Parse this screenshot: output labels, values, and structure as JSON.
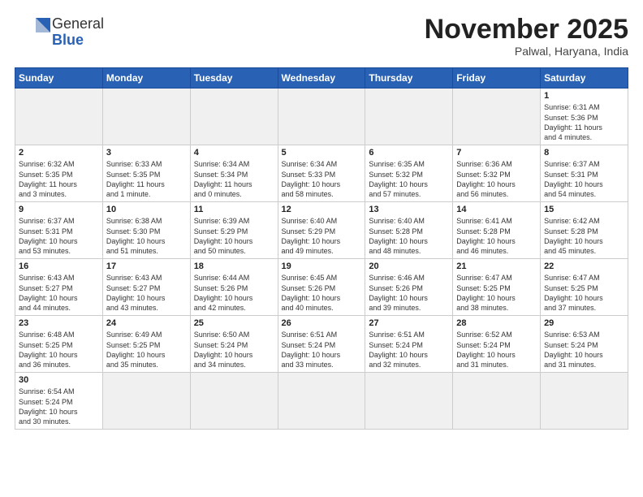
{
  "logo": {
    "text_normal": "General",
    "text_bold": "Blue"
  },
  "title": "November 2025",
  "subtitle": "Palwal, Haryana, India",
  "weekdays": [
    "Sunday",
    "Monday",
    "Tuesday",
    "Wednesday",
    "Thursday",
    "Friday",
    "Saturday"
  ],
  "weeks": [
    [
      {
        "day": "",
        "info": ""
      },
      {
        "day": "",
        "info": ""
      },
      {
        "day": "",
        "info": ""
      },
      {
        "day": "",
        "info": ""
      },
      {
        "day": "",
        "info": ""
      },
      {
        "day": "",
        "info": ""
      },
      {
        "day": "1",
        "info": "Sunrise: 6:31 AM\nSunset: 5:36 PM\nDaylight: 11 hours\nand 4 minutes."
      }
    ],
    [
      {
        "day": "2",
        "info": "Sunrise: 6:32 AM\nSunset: 5:35 PM\nDaylight: 11 hours\nand 3 minutes."
      },
      {
        "day": "3",
        "info": "Sunrise: 6:33 AM\nSunset: 5:35 PM\nDaylight: 11 hours\nand 1 minute."
      },
      {
        "day": "4",
        "info": "Sunrise: 6:34 AM\nSunset: 5:34 PM\nDaylight: 11 hours\nand 0 minutes."
      },
      {
        "day": "5",
        "info": "Sunrise: 6:34 AM\nSunset: 5:33 PM\nDaylight: 10 hours\nand 58 minutes."
      },
      {
        "day": "6",
        "info": "Sunrise: 6:35 AM\nSunset: 5:32 PM\nDaylight: 10 hours\nand 57 minutes."
      },
      {
        "day": "7",
        "info": "Sunrise: 6:36 AM\nSunset: 5:32 PM\nDaylight: 10 hours\nand 56 minutes."
      },
      {
        "day": "8",
        "info": "Sunrise: 6:37 AM\nSunset: 5:31 PM\nDaylight: 10 hours\nand 54 minutes."
      }
    ],
    [
      {
        "day": "9",
        "info": "Sunrise: 6:37 AM\nSunset: 5:31 PM\nDaylight: 10 hours\nand 53 minutes."
      },
      {
        "day": "10",
        "info": "Sunrise: 6:38 AM\nSunset: 5:30 PM\nDaylight: 10 hours\nand 51 minutes."
      },
      {
        "day": "11",
        "info": "Sunrise: 6:39 AM\nSunset: 5:29 PM\nDaylight: 10 hours\nand 50 minutes."
      },
      {
        "day": "12",
        "info": "Sunrise: 6:40 AM\nSunset: 5:29 PM\nDaylight: 10 hours\nand 49 minutes."
      },
      {
        "day": "13",
        "info": "Sunrise: 6:40 AM\nSunset: 5:28 PM\nDaylight: 10 hours\nand 48 minutes."
      },
      {
        "day": "14",
        "info": "Sunrise: 6:41 AM\nSunset: 5:28 PM\nDaylight: 10 hours\nand 46 minutes."
      },
      {
        "day": "15",
        "info": "Sunrise: 6:42 AM\nSunset: 5:28 PM\nDaylight: 10 hours\nand 45 minutes."
      }
    ],
    [
      {
        "day": "16",
        "info": "Sunrise: 6:43 AM\nSunset: 5:27 PM\nDaylight: 10 hours\nand 44 minutes."
      },
      {
        "day": "17",
        "info": "Sunrise: 6:43 AM\nSunset: 5:27 PM\nDaylight: 10 hours\nand 43 minutes."
      },
      {
        "day": "18",
        "info": "Sunrise: 6:44 AM\nSunset: 5:26 PM\nDaylight: 10 hours\nand 42 minutes."
      },
      {
        "day": "19",
        "info": "Sunrise: 6:45 AM\nSunset: 5:26 PM\nDaylight: 10 hours\nand 40 minutes."
      },
      {
        "day": "20",
        "info": "Sunrise: 6:46 AM\nSunset: 5:26 PM\nDaylight: 10 hours\nand 39 minutes."
      },
      {
        "day": "21",
        "info": "Sunrise: 6:47 AM\nSunset: 5:25 PM\nDaylight: 10 hours\nand 38 minutes."
      },
      {
        "day": "22",
        "info": "Sunrise: 6:47 AM\nSunset: 5:25 PM\nDaylight: 10 hours\nand 37 minutes."
      }
    ],
    [
      {
        "day": "23",
        "info": "Sunrise: 6:48 AM\nSunset: 5:25 PM\nDaylight: 10 hours\nand 36 minutes."
      },
      {
        "day": "24",
        "info": "Sunrise: 6:49 AM\nSunset: 5:25 PM\nDaylight: 10 hours\nand 35 minutes."
      },
      {
        "day": "25",
        "info": "Sunrise: 6:50 AM\nSunset: 5:24 PM\nDaylight: 10 hours\nand 34 minutes."
      },
      {
        "day": "26",
        "info": "Sunrise: 6:51 AM\nSunset: 5:24 PM\nDaylight: 10 hours\nand 33 minutes."
      },
      {
        "day": "27",
        "info": "Sunrise: 6:51 AM\nSunset: 5:24 PM\nDaylight: 10 hours\nand 32 minutes."
      },
      {
        "day": "28",
        "info": "Sunrise: 6:52 AM\nSunset: 5:24 PM\nDaylight: 10 hours\nand 31 minutes."
      },
      {
        "day": "29",
        "info": "Sunrise: 6:53 AM\nSunset: 5:24 PM\nDaylight: 10 hours\nand 31 minutes."
      }
    ],
    [
      {
        "day": "30",
        "info": "Sunrise: 6:54 AM\nSunset: 5:24 PM\nDaylight: 10 hours\nand 30 minutes."
      },
      {
        "day": "",
        "info": ""
      },
      {
        "day": "",
        "info": ""
      },
      {
        "day": "",
        "info": ""
      },
      {
        "day": "",
        "info": ""
      },
      {
        "day": "",
        "info": ""
      },
      {
        "day": "",
        "info": ""
      }
    ]
  ]
}
